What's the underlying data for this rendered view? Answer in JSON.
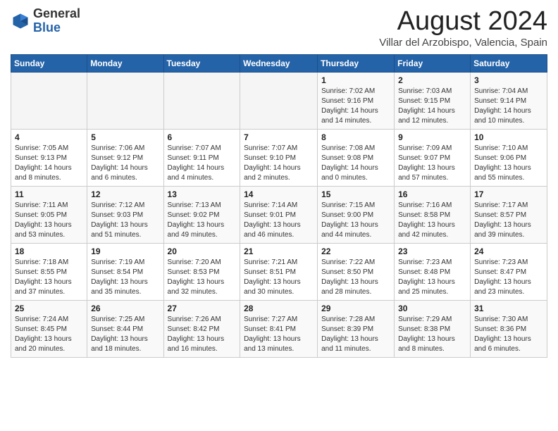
{
  "header": {
    "logo_general": "General",
    "logo_blue": "Blue",
    "month_title": "August 2024",
    "location": "Villar del Arzobispo, Valencia, Spain"
  },
  "calendar": {
    "days_of_week": [
      "Sunday",
      "Monday",
      "Tuesday",
      "Wednesday",
      "Thursday",
      "Friday",
      "Saturday"
    ],
    "weeks": [
      [
        {
          "day": "",
          "info": ""
        },
        {
          "day": "",
          "info": ""
        },
        {
          "day": "",
          "info": ""
        },
        {
          "day": "",
          "info": ""
        },
        {
          "day": "1",
          "info": "Sunrise: 7:02 AM\nSunset: 9:16 PM\nDaylight: 14 hours\nand 14 minutes."
        },
        {
          "day": "2",
          "info": "Sunrise: 7:03 AM\nSunset: 9:15 PM\nDaylight: 14 hours\nand 12 minutes."
        },
        {
          "day": "3",
          "info": "Sunrise: 7:04 AM\nSunset: 9:14 PM\nDaylight: 14 hours\nand 10 minutes."
        }
      ],
      [
        {
          "day": "4",
          "info": "Sunrise: 7:05 AM\nSunset: 9:13 PM\nDaylight: 14 hours\nand 8 minutes."
        },
        {
          "day": "5",
          "info": "Sunrise: 7:06 AM\nSunset: 9:12 PM\nDaylight: 14 hours\nand 6 minutes."
        },
        {
          "day": "6",
          "info": "Sunrise: 7:07 AM\nSunset: 9:11 PM\nDaylight: 14 hours\nand 4 minutes."
        },
        {
          "day": "7",
          "info": "Sunrise: 7:07 AM\nSunset: 9:10 PM\nDaylight: 14 hours\nand 2 minutes."
        },
        {
          "day": "8",
          "info": "Sunrise: 7:08 AM\nSunset: 9:08 PM\nDaylight: 14 hours\nand 0 minutes."
        },
        {
          "day": "9",
          "info": "Sunrise: 7:09 AM\nSunset: 9:07 PM\nDaylight: 13 hours\nand 57 minutes."
        },
        {
          "day": "10",
          "info": "Sunrise: 7:10 AM\nSunset: 9:06 PM\nDaylight: 13 hours\nand 55 minutes."
        }
      ],
      [
        {
          "day": "11",
          "info": "Sunrise: 7:11 AM\nSunset: 9:05 PM\nDaylight: 13 hours\nand 53 minutes."
        },
        {
          "day": "12",
          "info": "Sunrise: 7:12 AM\nSunset: 9:03 PM\nDaylight: 13 hours\nand 51 minutes."
        },
        {
          "day": "13",
          "info": "Sunrise: 7:13 AM\nSunset: 9:02 PM\nDaylight: 13 hours\nand 49 minutes."
        },
        {
          "day": "14",
          "info": "Sunrise: 7:14 AM\nSunset: 9:01 PM\nDaylight: 13 hours\nand 46 minutes."
        },
        {
          "day": "15",
          "info": "Sunrise: 7:15 AM\nSunset: 9:00 PM\nDaylight: 13 hours\nand 44 minutes."
        },
        {
          "day": "16",
          "info": "Sunrise: 7:16 AM\nSunset: 8:58 PM\nDaylight: 13 hours\nand 42 minutes."
        },
        {
          "day": "17",
          "info": "Sunrise: 7:17 AM\nSunset: 8:57 PM\nDaylight: 13 hours\nand 39 minutes."
        }
      ],
      [
        {
          "day": "18",
          "info": "Sunrise: 7:18 AM\nSunset: 8:55 PM\nDaylight: 13 hours\nand 37 minutes."
        },
        {
          "day": "19",
          "info": "Sunrise: 7:19 AM\nSunset: 8:54 PM\nDaylight: 13 hours\nand 35 minutes."
        },
        {
          "day": "20",
          "info": "Sunrise: 7:20 AM\nSunset: 8:53 PM\nDaylight: 13 hours\nand 32 minutes."
        },
        {
          "day": "21",
          "info": "Sunrise: 7:21 AM\nSunset: 8:51 PM\nDaylight: 13 hours\nand 30 minutes."
        },
        {
          "day": "22",
          "info": "Sunrise: 7:22 AM\nSunset: 8:50 PM\nDaylight: 13 hours\nand 28 minutes."
        },
        {
          "day": "23",
          "info": "Sunrise: 7:23 AM\nSunset: 8:48 PM\nDaylight: 13 hours\nand 25 minutes."
        },
        {
          "day": "24",
          "info": "Sunrise: 7:23 AM\nSunset: 8:47 PM\nDaylight: 13 hours\nand 23 minutes."
        }
      ],
      [
        {
          "day": "25",
          "info": "Sunrise: 7:24 AM\nSunset: 8:45 PM\nDaylight: 13 hours\nand 20 minutes."
        },
        {
          "day": "26",
          "info": "Sunrise: 7:25 AM\nSunset: 8:44 PM\nDaylight: 13 hours\nand 18 minutes."
        },
        {
          "day": "27",
          "info": "Sunrise: 7:26 AM\nSunset: 8:42 PM\nDaylight: 13 hours\nand 16 minutes."
        },
        {
          "day": "28",
          "info": "Sunrise: 7:27 AM\nSunset: 8:41 PM\nDaylight: 13 hours\nand 13 minutes."
        },
        {
          "day": "29",
          "info": "Sunrise: 7:28 AM\nSunset: 8:39 PM\nDaylight: 13 hours\nand 11 minutes."
        },
        {
          "day": "30",
          "info": "Sunrise: 7:29 AM\nSunset: 8:38 PM\nDaylight: 13 hours\nand 8 minutes."
        },
        {
          "day": "31",
          "info": "Sunrise: 7:30 AM\nSunset: 8:36 PM\nDaylight: 13 hours\nand 6 minutes."
        }
      ]
    ]
  }
}
